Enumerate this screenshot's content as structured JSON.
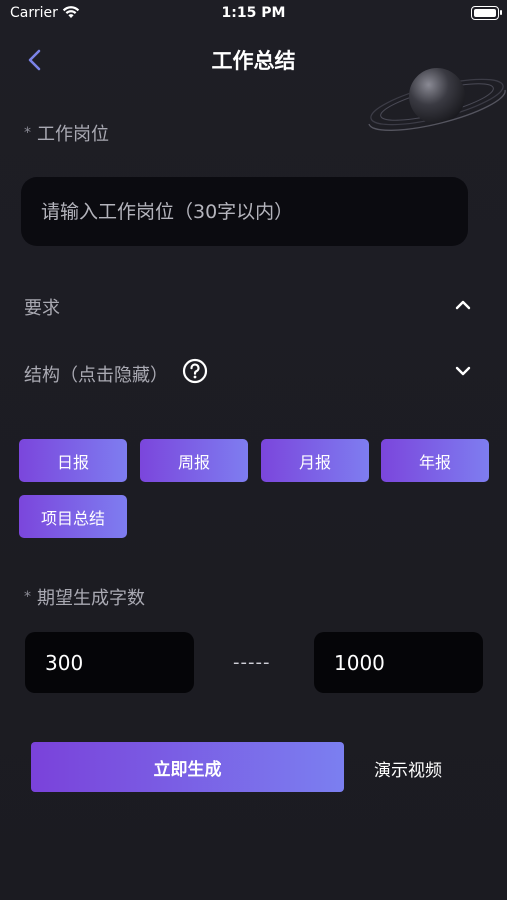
{
  "status_bar": {
    "carrier": "Carrier",
    "time": "1:15 PM"
  },
  "nav": {
    "title": "工作总结"
  },
  "job": {
    "label": "工作岗位",
    "required_mark": "*",
    "placeholder": "请输入工作岗位（30字以内）"
  },
  "requirements": {
    "label": "要求"
  },
  "structure": {
    "label": "结构（点击隐藏）"
  },
  "report_types": [
    "日报",
    "周报",
    "月报",
    "年报",
    "项目总结"
  ],
  "word_count": {
    "label": "期望生成字数",
    "required_mark": "*",
    "min": "300",
    "separator": "-----",
    "max": "1000"
  },
  "actions": {
    "generate": "立即生成",
    "demo": "演示视频"
  },
  "colors": {
    "background": "#1c1c22",
    "accent_start": "#7a42da",
    "accent_end": "#7b7ff0",
    "back_arrow": "#7b83e8"
  }
}
